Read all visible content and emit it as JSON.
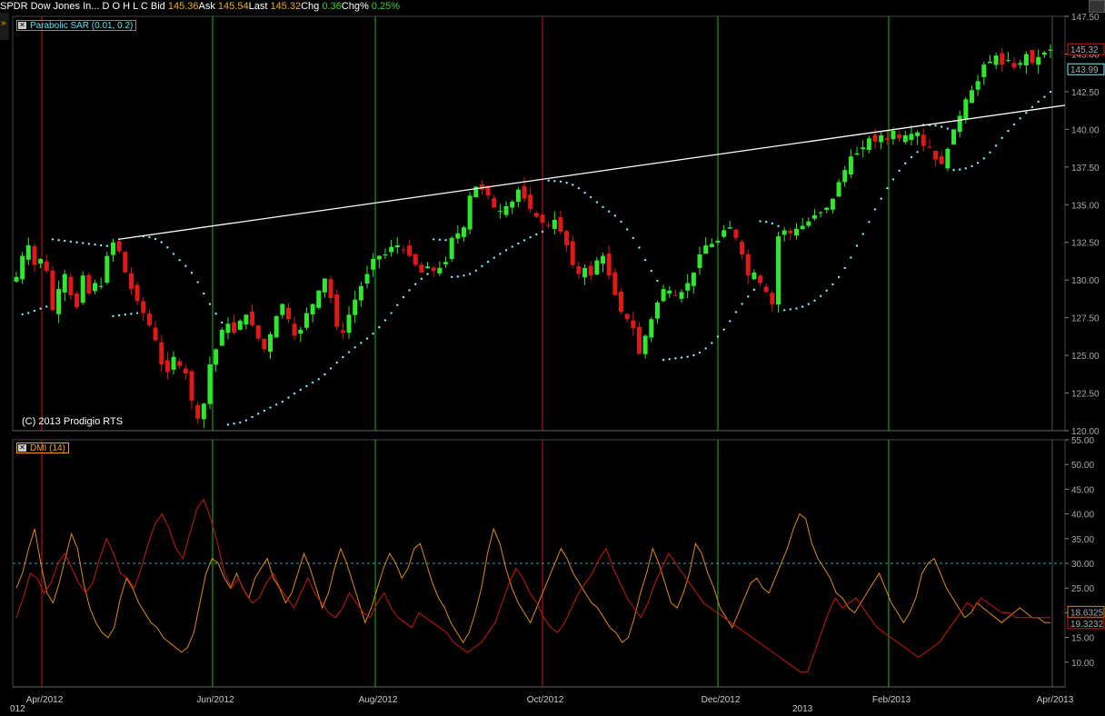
{
  "header": {
    "symbol": "SPDR Dow Jones In...",
    "ohlc": "D O H L C",
    "bid_label": "Bid",
    "bid": "145.36",
    "ask_label": "Ask",
    "ask": "145.54",
    "last_label": "Last",
    "last": "145.32",
    "chg_label": "Chg",
    "chg": "0.36",
    "chgpct_label": "Chg%",
    "chgpct": "0.25%"
  },
  "copyright": "(C) 2013 Prodigio RTS",
  "x_labels": {
    "corner_left": "012",
    "corner_year": "2013",
    "months": [
      "Apr/2012",
      "Jun/2012",
      "Aug/2012",
      "Oct/2012",
      "Dec/2012",
      "Feb/2013",
      "Apr/2013"
    ]
  },
  "colors": {
    "up": "#2ee82e",
    "down": "#e01818",
    "sar": "#7feeff",
    "dmi_plus": "#e08a10",
    "dmi_minus": "#cc1a0a",
    "trendline": "#ffffff"
  },
  "chart_data": [
    {
      "type": "candlestick",
      "legend": "Parabolic SAR (0.01, 0.2)",
      "ylim": [
        120,
        147.5
      ],
      "yticks": [
        "147.50",
        "145.00",
        "142.50",
        "140.00",
        "137.50",
        "135.00",
        "132.50",
        "130.00",
        "127.50",
        "125.00",
        "122.50",
        "120.00"
      ],
      "last_price_label": "145.32",
      "sar_label": "143.99",
      "close": [
        130.2,
        131.6,
        132.3,
        131.0,
        131.4,
        130.6,
        128.0,
        129.4,
        130.4,
        129.0,
        128.2,
        130.3,
        129.1,
        129.8,
        129.6,
        131.6,
        132.5,
        131.9,
        130.5,
        129.4,
        128.6,
        127.8,
        127.0,
        126.0,
        124.4,
        123.9,
        124.9,
        124.3,
        123.8,
        122.0,
        120.8,
        121.8,
        124.4,
        125.4,
        126.7,
        127.1,
        126.5,
        127.3,
        127.7,
        127.0,
        126.1,
        125.4,
        126.4,
        127.6,
        128.4,
        127.4,
        126.3,
        126.7,
        127.8,
        128.4,
        129.3,
        130.1,
        128.8,
        126.9,
        126.5,
        127.7,
        128.7,
        129.6,
        130.4,
        131.4,
        131.6,
        131.7,
        132.2,
        132.3,
        132.0,
        131.6,
        131.0,
        130.5,
        130.9,
        130.6,
        130.8,
        131.2,
        132.8,
        133.1,
        133.5,
        135.6,
        136.2,
        136.0,
        135.6,
        134.8,
        134.6,
        134.9,
        135.2,
        136.0,
        135.4,
        134.7,
        134.2,
        133.8,
        133.6,
        134.0,
        133.2,
        132.3,
        131.0,
        130.4,
        130.8,
        130.3,
        131.3,
        131.6,
        130.3,
        129.0,
        127.9,
        127.4,
        126.8,
        125.1,
        126.3,
        127.4,
        128.5,
        129.4,
        129.3,
        129.0,
        129.2,
        129.8,
        130.5,
        131.7,
        132.3,
        132.4,
        132.6,
        133.3,
        133.5,
        132.8,
        131.7,
        130.3,
        130.5,
        129.8,
        129.2,
        128.4,
        132.9,
        133.3,
        133.1,
        133.4,
        133.6,
        133.9,
        134.3,
        134.5,
        134.8,
        135.4,
        136.5,
        137.3,
        138.2,
        138.4,
        138.8,
        139.4,
        139.2,
        139.6,
        139.3,
        139.9,
        139.4,
        139.6,
        139.7,
        139.8,
        138.9,
        138.8,
        138.0,
        137.7,
        138.7,
        140.0,
        140.9,
        142.0,
        142.6,
        143.2,
        144.3,
        144.5,
        144.9,
        144.3,
        144.6,
        144.1,
        144.4,
        145.0,
        144.4,
        144.8,
        145.1,
        145.3
      ]
    },
    {
      "type": "line",
      "legend": "DMI (14)",
      "ylim": [
        5,
        55
      ],
      "yticks": [
        "55.00",
        "50.00",
        "45.00",
        "40.00",
        "35.00",
        "30.00",
        "25.00",
        "20.00",
        "15.00",
        "10.00"
      ],
      "reference_line": 30,
      "series": [
        {
          "values": [
            25,
            28,
            33,
            37,
            30,
            24,
            22,
            26,
            31,
            36,
            33,
            26,
            21,
            18,
            16,
            15,
            17,
            23,
            27,
            25,
            22,
            20,
            18,
            17,
            15,
            14,
            13,
            12,
            13,
            16,
            22,
            28,
            31,
            30,
            27,
            25,
            28,
            25,
            23,
            27,
            29,
            31,
            27,
            25,
            22,
            24,
            28,
            32,
            29,
            25,
            21,
            24,
            29,
            33,
            30,
            26,
            22,
            18,
            21,
            25,
            29,
            32,
            30,
            27,
            29,
            33,
            34,
            30,
            26,
            23,
            21,
            18,
            16,
            14,
            16,
            20,
            25,
            32,
            37,
            34,
            29,
            25,
            22,
            20,
            18,
            21,
            24,
            27,
            30,
            33,
            31,
            28,
            26,
            24,
            22,
            21,
            19,
            17,
            16,
            14,
            15,
            19,
            24,
            28,
            33,
            30,
            26,
            22,
            21,
            24,
            28,
            34,
            32,
            28,
            25,
            21,
            19,
            17,
            20,
            23,
            26,
            27,
            25,
            24,
            27,
            30,
            33,
            37,
            40,
            39,
            34,
            31,
            29,
            27,
            24,
            23,
            21,
            20,
            22,
            24,
            26,
            28,
            25,
            22,
            20,
            18,
            20,
            23,
            28,
            30,
            31,
            28,
            25,
            23,
            21,
            19,
            20,
            22,
            21,
            20,
            19,
            18,
            19,
            20,
            21,
            20,
            19,
            19,
            18,
            18
          ]
        },
        {
          "values": [
            19,
            23,
            28,
            27,
            24,
            26,
            30,
            32,
            29,
            26,
            24,
            26,
            31,
            35,
            32,
            28,
            27,
            25,
            29,
            34,
            38,
            40,
            37,
            33,
            31,
            36,
            41,
            43,
            39,
            34,
            28,
            25,
            27,
            24,
            22,
            23,
            26,
            28,
            25,
            23,
            21,
            24,
            27,
            24,
            22,
            20,
            19,
            21,
            24,
            22,
            20,
            19,
            22,
            24,
            21,
            19,
            18,
            17,
            20,
            19,
            18,
            17,
            16,
            14,
            13,
            12,
            13,
            14,
            16,
            18,
            22,
            26,
            29,
            27,
            24,
            22,
            19,
            17,
            16,
            18,
            21,
            24,
            26,
            28,
            31,
            33,
            29,
            26,
            23,
            21,
            19,
            22,
            26,
            29,
            32,
            30,
            28,
            26,
            24,
            22,
            21,
            20,
            19,
            18,
            17,
            16,
            15,
            14,
            13,
            12,
            11,
            10,
            9,
            8,
            8,
            12,
            16,
            20,
            23,
            21,
            22,
            23,
            21,
            19,
            17,
            16,
            15,
            14,
            13,
            12,
            11,
            12,
            13,
            14,
            16,
            18,
            20,
            22,
            21,
            23,
            22,
            21,
            20,
            20,
            19,
            19,
            19,
            19,
            19,
            19
          ]
        }
      ],
      "plus_value_label": "18.6325",
      "minus_value_label": "19.3232"
    }
  ]
}
